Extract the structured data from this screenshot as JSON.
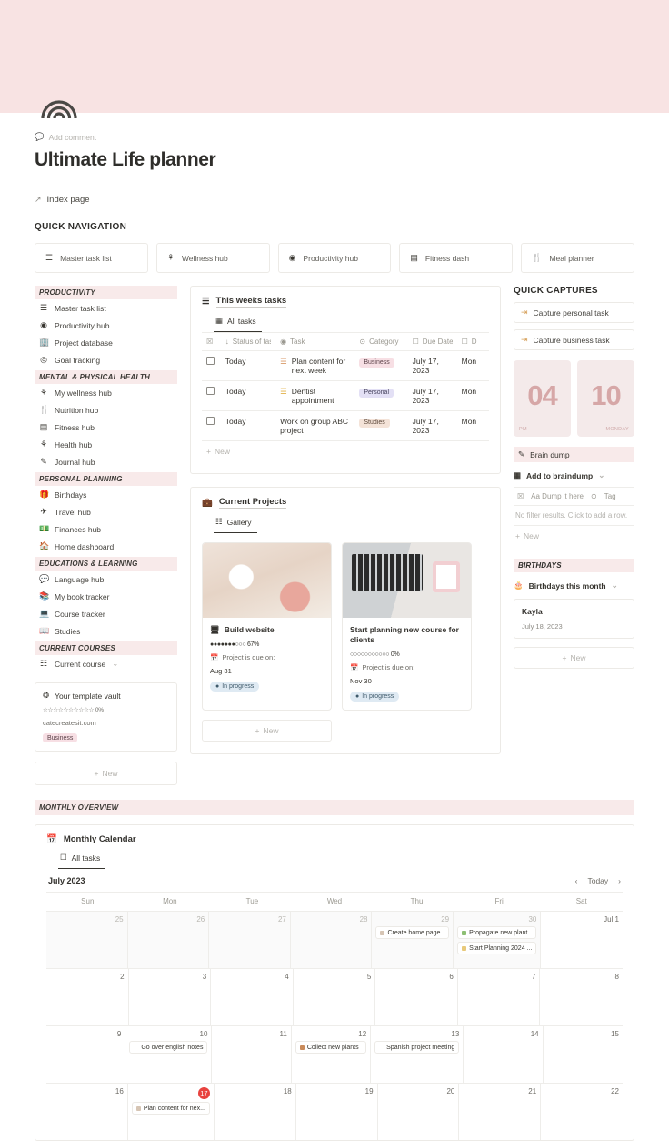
{
  "header": {
    "page_icon": "rainbow-icon",
    "add_comment": "Add comment",
    "title": "Ultimate Life planner",
    "index_link": "Index page",
    "banner_color": "#f8e3e3"
  },
  "quick_navigation": {
    "heading": "QUICK NAVIGATION",
    "items": [
      {
        "label": "Master task list",
        "icon": "list-icon"
      },
      {
        "label": "Wellness hub",
        "icon": "lotus-icon"
      },
      {
        "label": "Productivity hub",
        "icon": "target-icon"
      },
      {
        "label": "Fitness dash",
        "icon": "dumbbell-icon"
      },
      {
        "label": "Meal planner",
        "icon": "fork-plate-icon"
      }
    ]
  },
  "sidebar": {
    "groups": [
      {
        "heading": "PRODUCTIVITY",
        "items": [
          {
            "label": "Master task list",
            "icon": "list-icon"
          },
          {
            "label": "Productivity hub",
            "icon": "target-icon"
          },
          {
            "label": "Project database",
            "icon": "building-icon"
          },
          {
            "label": "Goal tracking",
            "icon": "dart-icon"
          }
        ]
      },
      {
        "heading": "MENTAL & PHYSICAL HEALTH",
        "items": [
          {
            "label": "My wellness hub",
            "icon": "lotus-icon"
          },
          {
            "label": "Nutrition hub",
            "icon": "fork-plate-icon"
          },
          {
            "label": "Fitness hub",
            "icon": "dumbbell-icon"
          },
          {
            "label": "Health hub",
            "icon": "lotus-icon"
          },
          {
            "label": "Journal hub",
            "icon": "pencil-icon"
          }
        ]
      },
      {
        "heading": "PERSONAL PLANNING",
        "items": [
          {
            "label": "Birthdays",
            "icon": "gift-icon"
          },
          {
            "label": "Travel hub",
            "icon": "airplane-icon"
          },
          {
            "label": "Finances hub",
            "icon": "money-icon"
          },
          {
            "label": "Home dashboard",
            "icon": "house-icon"
          }
        ]
      },
      {
        "heading": "EDUCATIONS & LEARNING",
        "items": [
          {
            "label": "Language hub",
            "icon": "speech-bubbles-icon"
          },
          {
            "label": "My book tracker",
            "icon": "books-icon"
          },
          {
            "label": "Course tracker",
            "icon": "laptop-icon"
          },
          {
            "label": "Studies",
            "icon": "notebook-icon"
          }
        ]
      },
      {
        "heading": "CURRENT COURSES",
        "items": [
          {
            "label": "Current course",
            "icon": "gallery-icon",
            "chevron": "⌄"
          }
        ]
      }
    ],
    "vault_card": {
      "title": "Your template vault",
      "icon": "rosette-icon",
      "stars": "☆☆☆☆☆☆☆☆☆☆",
      "progress": "0%",
      "url": "catecreatesit.com",
      "tag": "Business"
    },
    "new_label": "New"
  },
  "tasks_block": {
    "title": "This weeks tasks",
    "icon": "list-icon",
    "view_tab": "All tasks",
    "view_icon": "table-icon",
    "columns": [
      {
        "label": "",
        "icon": "checkbox-icon"
      },
      {
        "label": "Status of task",
        "icon": "sort-icon"
      },
      {
        "label": "Task",
        "icon": "clock-icon"
      },
      {
        "label": "Category",
        "icon": "select-icon"
      },
      {
        "label": "Due Date",
        "icon": "date-icon"
      },
      {
        "label": "D",
        "icon": "date-icon"
      }
    ],
    "rows": [
      {
        "status": "Today",
        "task": "Plan content for next week",
        "task_icon": "list-icon",
        "category": "Business",
        "category_color": "business",
        "due_date": "July 17, 2023",
        "day": "Mon"
      },
      {
        "status": "Today",
        "task": "Dentist appointment",
        "task_icon": "list-icon",
        "category": "Personal",
        "category_color": "personal",
        "due_date": "July 17, 2023",
        "day": "Mon"
      },
      {
        "status": "Today",
        "task": "Work on group ABC project",
        "task_icon": "",
        "category": "Studies",
        "category_color": "studies",
        "due_date": "July 17, 2023",
        "day": "Mon"
      }
    ],
    "new_label": "New"
  },
  "projects_block": {
    "title": "Current Projects",
    "icon": "briefcase-icon",
    "view_tab": "Gallery",
    "view_icon": "gallery-icon",
    "cards": [
      {
        "title": "Build website",
        "title_icon": "computer-icon",
        "progress_bar": "●●●●●●●○○○",
        "progress": "67%",
        "due_label": "Project is due on:",
        "due_date": "Aug 31",
        "status": "In progress",
        "image": "coffee-desk-photo"
      },
      {
        "title": "Start planning new course for clients",
        "title_icon": "",
        "progress_bar": "○○○○○○○○○○○",
        "progress": "0%",
        "due_label": "Project is due on:",
        "due_date": "Nov 30",
        "status": "In progress",
        "image": "laptop-mug-photo"
      }
    ],
    "new_label": "New"
  },
  "quick_captures": {
    "heading": "QUICK CAPTURES",
    "buttons": [
      {
        "label": "Capture personal task",
        "icon": "arrow-into-bar-icon"
      },
      {
        "label": "Capture business task",
        "icon": "arrow-into-bar-icon"
      }
    ],
    "clock": {
      "hour": "04",
      "meridiem": "PM",
      "day_number": "10",
      "weekday": "MONDAY",
      "color": "#d6a7a7"
    },
    "brain_dump": {
      "label": "Brain dump",
      "icon": "pencil-icon",
      "database_label": "Add to braindump",
      "database_icon": "table-icon",
      "chevron": "⌄",
      "columns": [
        {
          "label": "",
          "icon": "checkbox-icon"
        },
        {
          "label": "Aa Dump it here",
          "icon": ""
        },
        {
          "label": "Tag",
          "icon": "select-icon"
        }
      ],
      "empty_text": "No filter results. Click to add a row.",
      "new_label": "New"
    }
  },
  "birthdays": {
    "heading": "BIRTHDAYS",
    "filter_label": "Birthdays this month",
    "filter_icon": "cake-icon",
    "chevron": "⌄",
    "entries": [
      {
        "name": "Kayla",
        "date": "July 18, 2023"
      }
    ],
    "new_label": "New"
  },
  "monthly_overview": {
    "heading": "MONTHLY OVERVIEW",
    "calendar": {
      "title": "Monthly Calendar",
      "icon": "calendar-icon",
      "view_tab": "All tasks",
      "view_icon": "calendar-icon",
      "month": "July 2023",
      "today_label": "Today",
      "prev_icon": "chevron-left-icon",
      "next_icon": "chevron-right-icon",
      "day_names": [
        "Sun",
        "Mon",
        "Tue",
        "Wed",
        "Thu",
        "Fri",
        "Sat"
      ],
      "weeks": [
        {
          "days": [
            {
              "label": "25",
              "out": true,
              "events": []
            },
            {
              "label": "26",
              "out": true,
              "events": []
            },
            {
              "label": "27",
              "out": true,
              "events": []
            },
            {
              "label": "28",
              "out": true,
              "events": []
            },
            {
              "label": "29",
              "out": true,
              "events": [
                {
                  "text": "Create home page",
                  "color": "#d6c5b4"
                }
              ]
            },
            {
              "label": "30",
              "out": true,
              "events": [
                {
                  "text": "Propagate new plant",
                  "color": "#8dbf73"
                },
                {
                  "text": "Start Planning 2024 ...",
                  "color": "#e8c97a"
                }
              ]
            },
            {
              "label": "Jul 1",
              "out": false,
              "events": []
            }
          ]
        },
        {
          "days": [
            {
              "label": "2",
              "out": false,
              "events": []
            },
            {
              "label": "3",
              "out": false,
              "events": []
            },
            {
              "label": "4",
              "out": false,
              "events": []
            },
            {
              "label": "5",
              "out": false,
              "events": []
            },
            {
              "label": "6",
              "out": false,
              "events": []
            },
            {
              "label": "7",
              "out": false,
              "events": []
            },
            {
              "label": "8",
              "out": false,
              "events": []
            }
          ]
        },
        {
          "days": [
            {
              "label": "9",
              "out": false,
              "events": []
            },
            {
              "label": "10",
              "out": false,
              "events": [
                {
                  "text": "Go over english notes",
                  "color": "#ffffff"
                }
              ]
            },
            {
              "label": "11",
              "out": false,
              "events": []
            },
            {
              "label": "12",
              "out": false,
              "events": [
                {
                  "text": "Collect new plants",
                  "color": "#c98a5a"
                }
              ]
            },
            {
              "label": "13",
              "out": false,
              "events": [
                {
                  "text": "Spanish project meeting",
                  "color": "#ffffff"
                }
              ]
            },
            {
              "label": "14",
              "out": false,
              "events": []
            },
            {
              "label": "15",
              "out": false,
              "events": []
            }
          ]
        },
        {
          "days": [
            {
              "label": "16",
              "out": false,
              "events": []
            },
            {
              "label": "17",
              "out": false,
              "today": true,
              "events": [
                {
                  "text": "Plan content for nex...",
                  "color": "#d6c5b4"
                }
              ]
            },
            {
              "label": "18",
              "out": false,
              "events": []
            },
            {
              "label": "19",
              "out": false,
              "events": []
            },
            {
              "label": "20",
              "out": false,
              "events": []
            },
            {
              "label": "21",
              "out": false,
              "events": []
            },
            {
              "label": "22",
              "out": false,
              "events": []
            }
          ]
        }
      ]
    }
  }
}
